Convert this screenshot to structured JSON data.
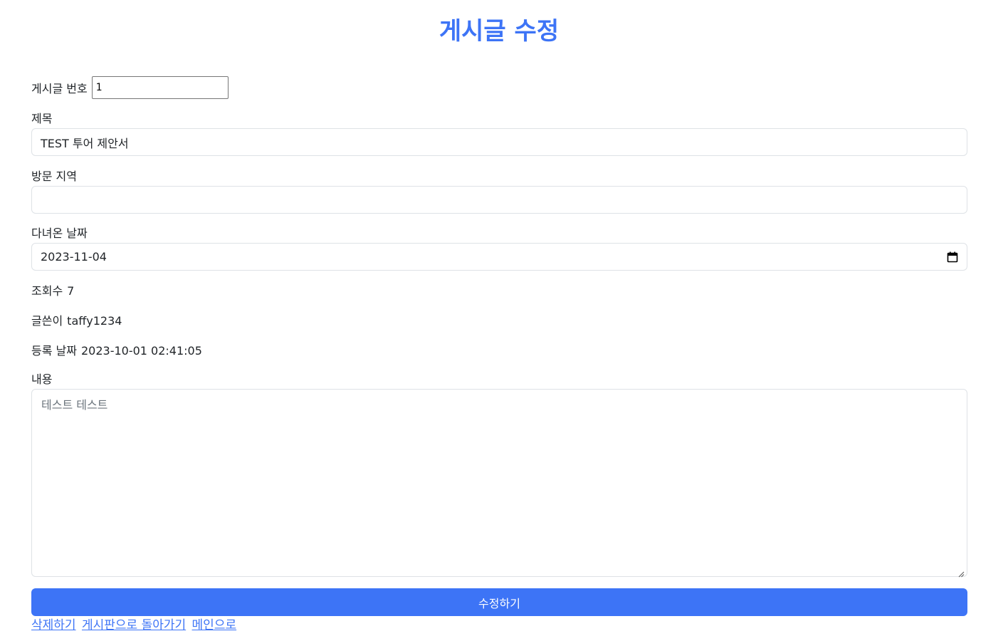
{
  "page": {
    "title": "게시글 수정"
  },
  "form": {
    "post_no": {
      "label": "게시글 번호",
      "value": "1"
    },
    "title": {
      "label": "제목",
      "value": "TEST 투어 제안서"
    },
    "region": {
      "label": "방문 지역",
      "value": ""
    },
    "visit_date": {
      "label": "다녀온 날짜",
      "value": "2023-11-04"
    },
    "views": {
      "label": "조회수",
      "value": "7"
    },
    "author": {
      "label": "글쓴이",
      "value": "taffy1234"
    },
    "reg_date": {
      "label": "등록 날짜",
      "value": "2023-10-01 02:41:05"
    },
    "content": {
      "label": "내용",
      "placeholder": "테스트 테스트"
    },
    "submit_label": "수정하기"
  },
  "links": {
    "delete": "삭제하기",
    "back_to_board": "게시판으로 돌아가기",
    "to_main": "메인으로"
  },
  "colors": {
    "accent": "#3d74f6",
    "border": "#dee2e6",
    "placeholder": "#6c757d"
  },
  "icons": {
    "date_picker": "calendar-icon",
    "resize": "resize-handle-icon"
  }
}
